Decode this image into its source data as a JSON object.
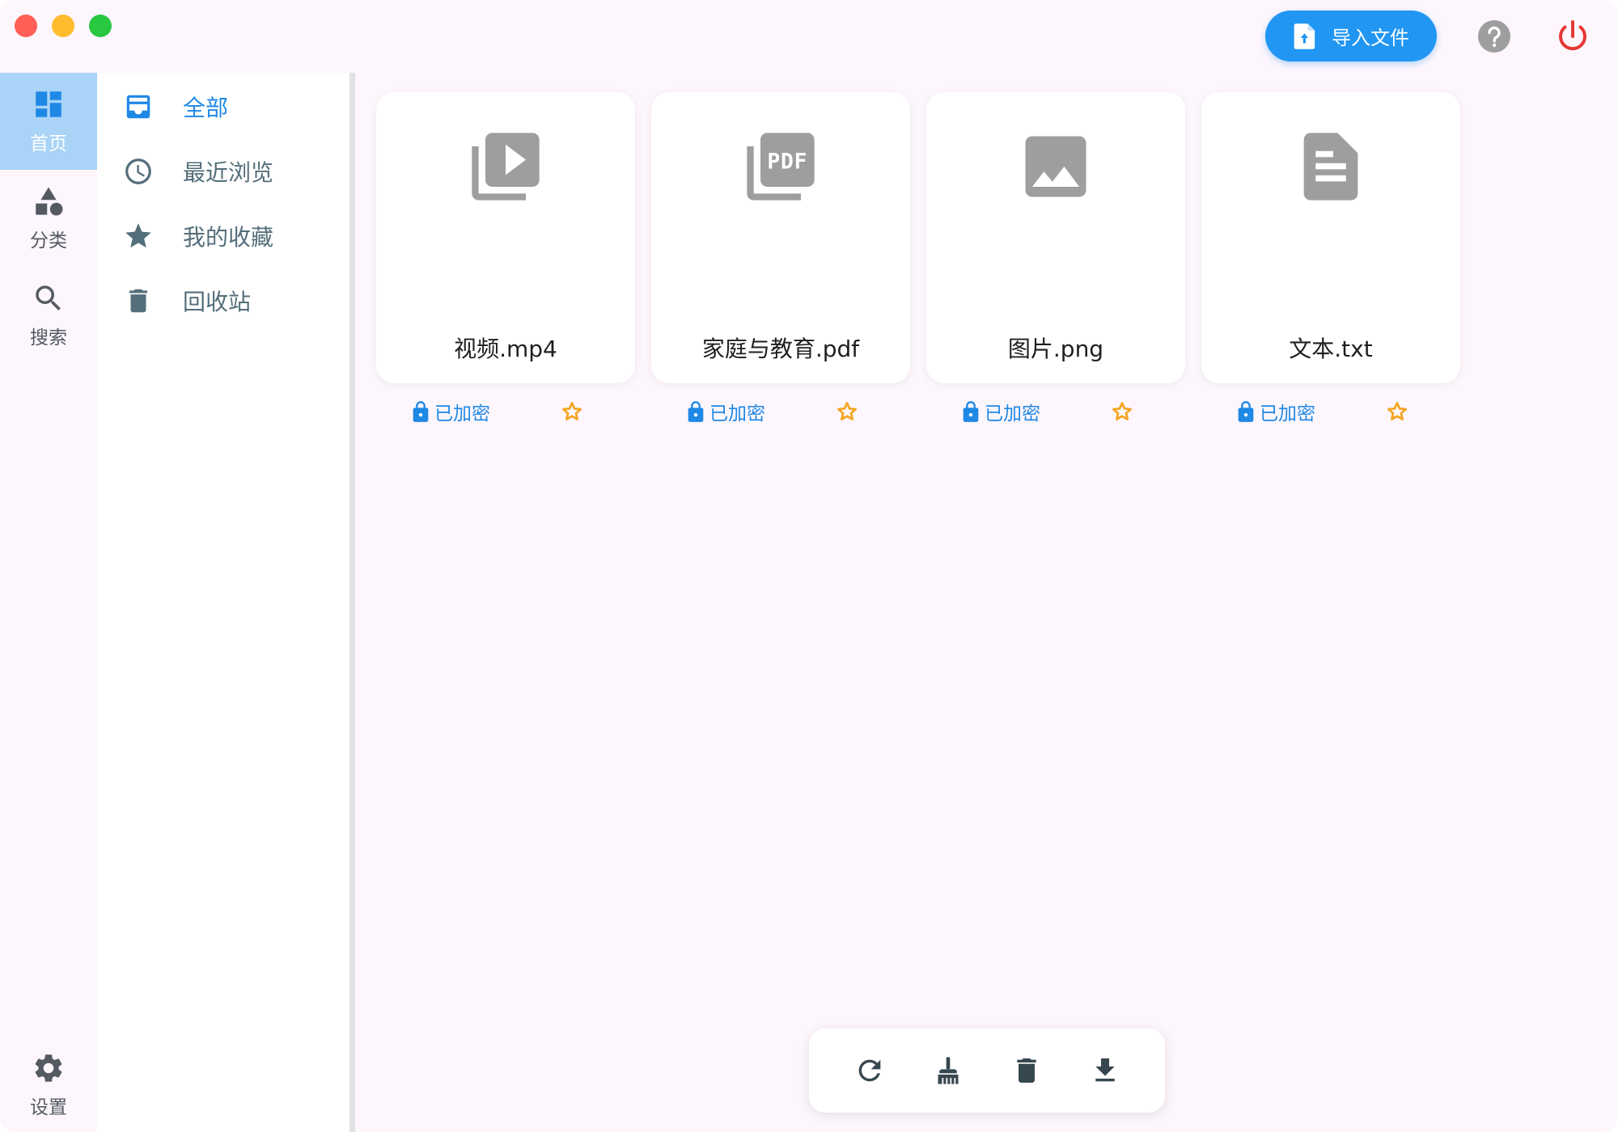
{
  "topbar": {
    "import_label": "导入文件"
  },
  "rail": {
    "items": [
      {
        "label": "首页",
        "icon": "dashboard-icon",
        "active": true
      },
      {
        "label": "分类",
        "icon": "category-shapes-icon"
      },
      {
        "label": "搜索",
        "icon": "search-icon"
      },
      {
        "label": "设置",
        "icon": "gear-icon"
      }
    ]
  },
  "subnav": {
    "items": [
      {
        "label": "全部",
        "icon": "inbox-icon",
        "active": true
      },
      {
        "label": "最近浏览",
        "icon": "clock-icon"
      },
      {
        "label": "我的收藏",
        "icon": "star-icon"
      },
      {
        "label": "回收站",
        "icon": "trash-icon"
      }
    ]
  },
  "files": [
    {
      "name": "视频.mp4",
      "icon": "video-library-icon",
      "status": "已加密"
    },
    {
      "name": "家庭与教育.pdf",
      "icon": "pdf-icon",
      "status": "已加密"
    },
    {
      "name": "图片.png",
      "icon": "image-icon",
      "status": "已加密"
    },
    {
      "name": "文本.txt",
      "icon": "text-document-icon",
      "status": "已加密"
    }
  ],
  "toolbar": {
    "tools": [
      "refresh-icon",
      "broom-icon",
      "trash-icon",
      "download-icon"
    ]
  },
  "colors": {
    "accent": "#2196f3",
    "star": "#f5a623",
    "power": "#e53935",
    "icon_gray": "#9e9e9e"
  }
}
